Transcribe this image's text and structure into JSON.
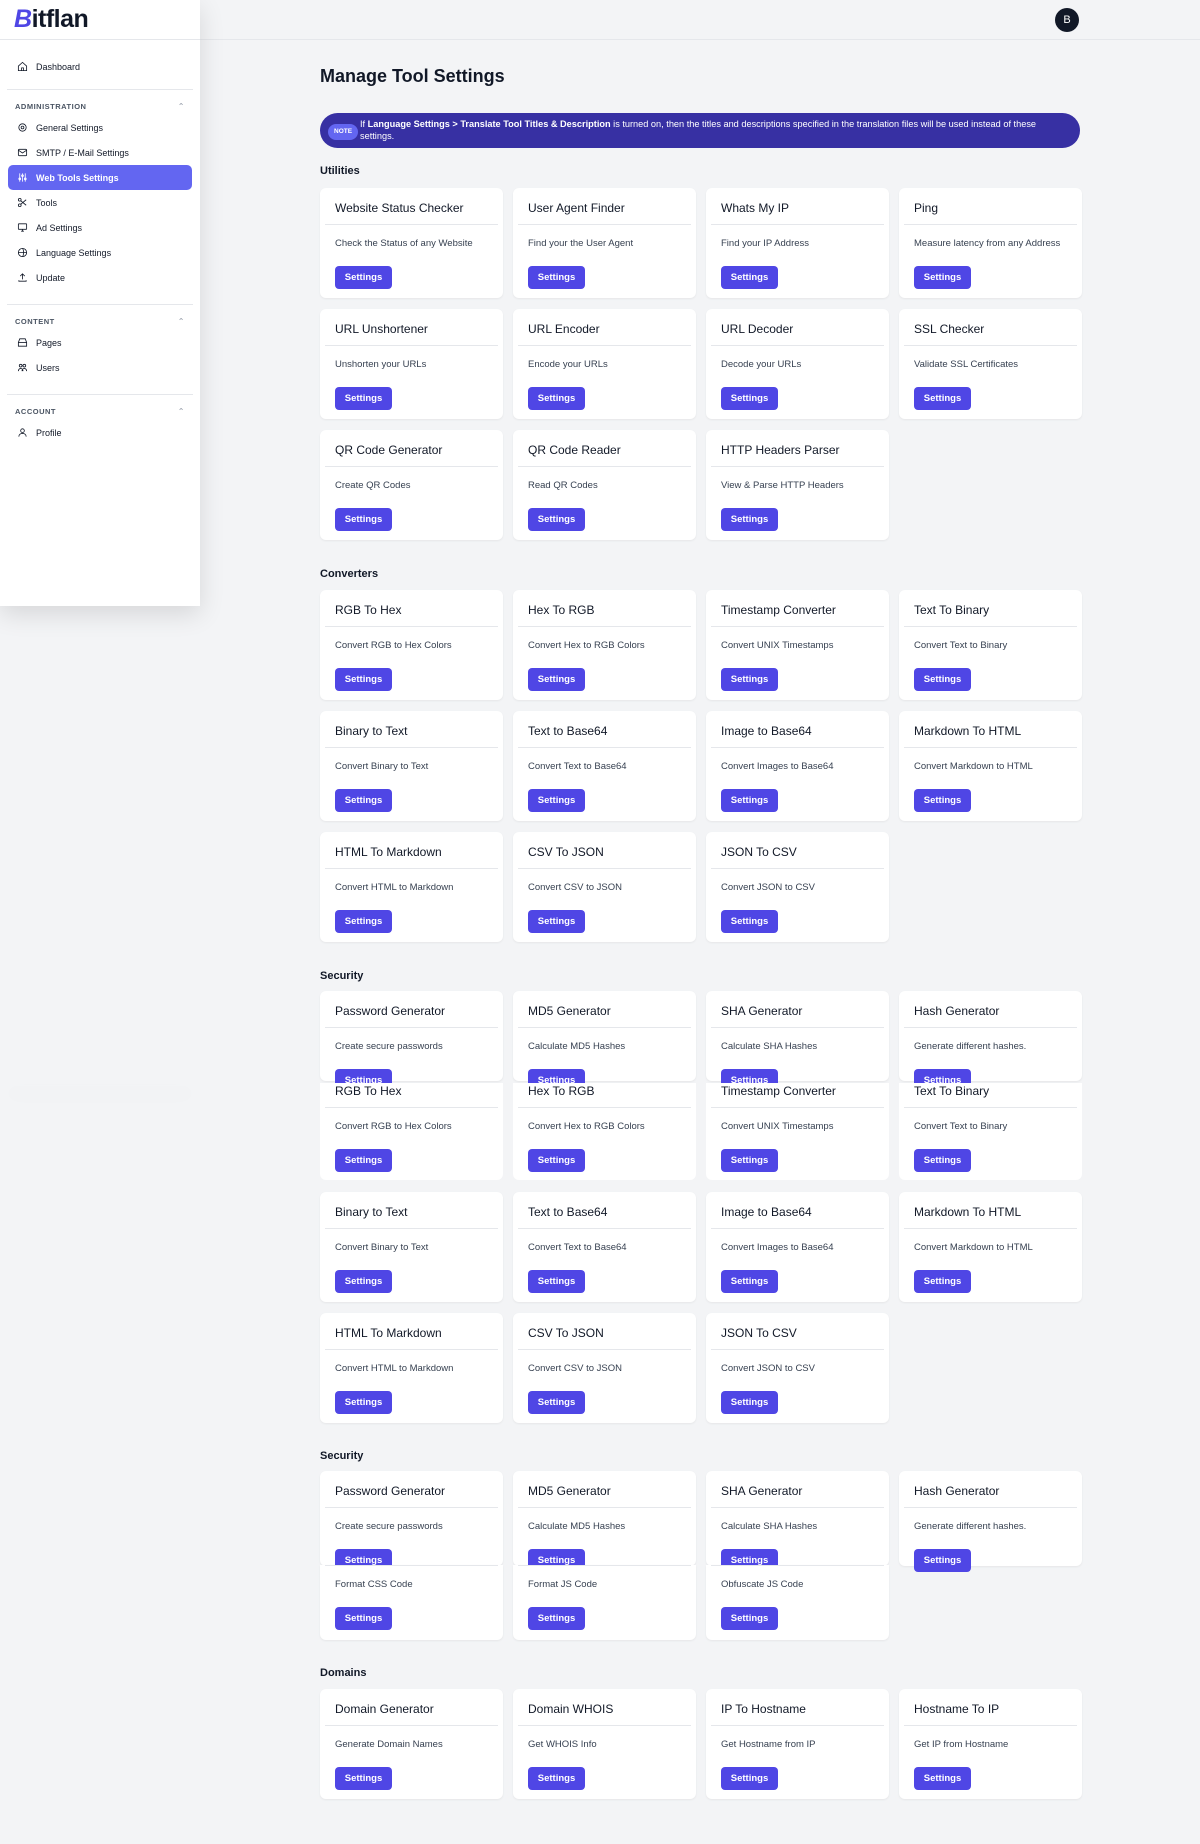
{
  "brand": {
    "logo_text_b": "B",
    "logo_text_rest": "itflan"
  },
  "user": {
    "avatar_initial": "B"
  },
  "sidebar": {
    "dashboard": "Dashboard",
    "sections": [
      {
        "title": "ADMINISTRATION",
        "items": [
          "General Settings",
          "SMTP / E-Mail Settings",
          "Web Tools Settings",
          "Tools",
          "Ad Settings",
          "Language Settings",
          "Update"
        ]
      },
      {
        "title": "CONTENT",
        "items": [
          "Pages",
          "Users"
        ]
      },
      {
        "title": "ACCOUNT",
        "items": [
          "Profile"
        ]
      }
    ],
    "active_item": "Web Tools Settings"
  },
  "page": {
    "title": "Manage Tool Settings",
    "note": {
      "badge": "NOTE",
      "prefix": "If ",
      "bold": "Language Settings > Translate Tool Titles & Description",
      "suffix": " is turned on, then the titles and descriptions specified in the translation files will be used instead of these settings."
    },
    "button_label": "Settings"
  },
  "sections": {
    "utilities": {
      "title": "Utilities",
      "tools": [
        {
          "title": "Website Status Checker",
          "desc": "Check the Status of any Website"
        },
        {
          "title": "User Agent Finder",
          "desc": "Find your the User Agent"
        },
        {
          "title": "Whats My IP",
          "desc": "Find your IP Address"
        },
        {
          "title": "Ping",
          "desc": "Measure latency from any Address"
        },
        {
          "title": "URL Unshortener",
          "desc": "Unshorten your URLs"
        },
        {
          "title": "URL Encoder",
          "desc": "Encode your URLs"
        },
        {
          "title": "URL Decoder",
          "desc": "Decode your URLs"
        },
        {
          "title": "SSL Checker",
          "desc": "Validate SSL Certificates"
        },
        {
          "title": "QR Code Generator",
          "desc": "Create QR Codes"
        },
        {
          "title": "QR Code Reader",
          "desc": "Read QR Codes"
        },
        {
          "title": "HTTP Headers Parser",
          "desc": "View & Parse HTTP Headers"
        }
      ]
    },
    "converters": {
      "title": "Converters",
      "tools": [
        {
          "title": "RGB To Hex",
          "desc": "Convert RGB to Hex Colors"
        },
        {
          "title": "Hex To RGB",
          "desc": "Convert Hex to RGB Colors"
        },
        {
          "title": "Timestamp Converter",
          "desc": "Convert UNIX Timestamps"
        },
        {
          "title": "Text To Binary",
          "desc": "Convert Text to Binary"
        },
        {
          "title": "Binary to Text",
          "desc": "Convert Binary to Text"
        },
        {
          "title": "Text to Base64",
          "desc": "Convert Text to Base64"
        },
        {
          "title": "Image to Base64",
          "desc": "Convert Images to Base64"
        },
        {
          "title": "Markdown To HTML",
          "desc": "Convert Markdown to HTML"
        },
        {
          "title": "HTML To Markdown",
          "desc": "Convert HTML to Markdown"
        },
        {
          "title": "CSV To JSON",
          "desc": "Convert CSV to JSON"
        },
        {
          "title": "JSON To CSV",
          "desc": "Convert JSON to CSV"
        }
      ]
    },
    "security": {
      "title": "Security",
      "tools": [
        {
          "title": "Password Generator",
          "desc": "Create secure passwords"
        },
        {
          "title": "MD5 Generator",
          "desc": "Calculate MD5 Hashes"
        },
        {
          "title": "SHA Generator",
          "desc": "Calculate SHA Hashes"
        },
        {
          "title": "Hash Generator",
          "desc": "Generate different hashes."
        }
      ]
    },
    "formatters_partial": {
      "tools": [
        {
          "desc": "Format CSS Code"
        },
        {
          "desc": "Format JS Code"
        },
        {
          "desc": "Obfuscate JS Code"
        }
      ]
    },
    "domains": {
      "title": "Domains",
      "tools": [
        {
          "title": "Domain Generator",
          "desc": "Generate Domain Names"
        },
        {
          "title": "Domain WHOIS",
          "desc": "Get WHOIS Info"
        },
        {
          "title": "IP To Hostname",
          "desc": "Get Hostname from IP"
        },
        {
          "title": "Hostname To IP",
          "desc": "Get IP from Hostname"
        }
      ]
    }
  }
}
